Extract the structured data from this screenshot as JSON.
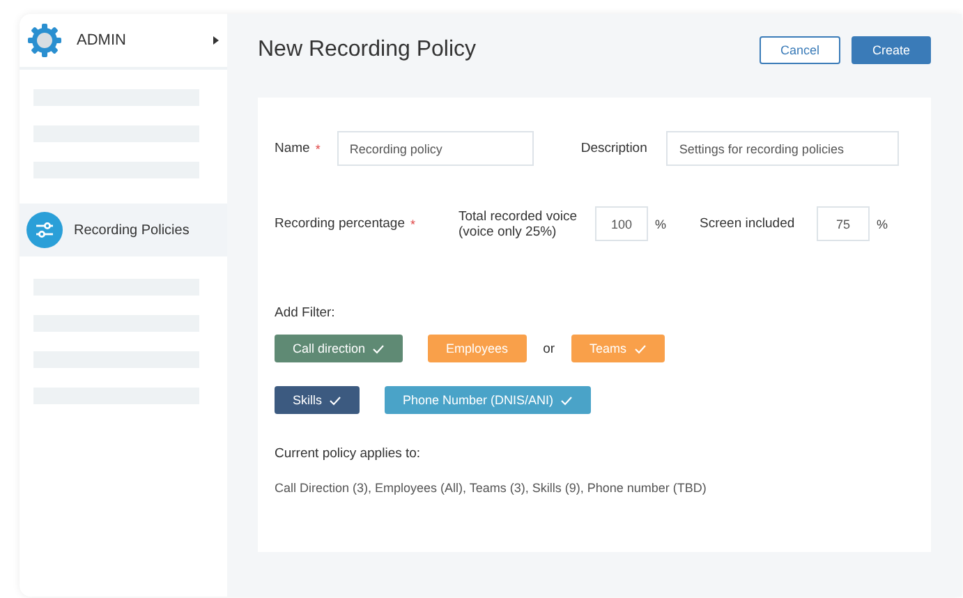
{
  "sidebar": {
    "title": "ADMIN",
    "items": [
      {
        "kind": "placeholder"
      },
      {
        "kind": "placeholder"
      },
      {
        "kind": "placeholder"
      },
      {
        "kind": "item",
        "label": "Recording Policies",
        "selected": true
      },
      {
        "kind": "placeholder"
      },
      {
        "kind": "placeholder"
      },
      {
        "kind": "placeholder"
      },
      {
        "kind": "placeholder"
      }
    ]
  },
  "page": {
    "title": "New Recording Policy",
    "buttons": [
      {
        "label": "Cancel",
        "kind": "secondary"
      },
      {
        "label": "Create",
        "kind": "primary"
      }
    ]
  },
  "form": {
    "name": {
      "label": "Name",
      "required_mark": "*",
      "value": "Recording policy"
    },
    "description": {
      "label": "Description",
      "value": "Settings for recording policies"
    },
    "recording": {
      "label": "Recording percentage",
      "required_mark": "*",
      "total_label": "Total recorded voice (voice only 25%)",
      "total_value": "100",
      "total_unit": "%",
      "screen_label": "Screen included",
      "screen_value": "75",
      "screen_unit": "%"
    },
    "filter_label": "Add Filter:",
    "filter_rows": [
      [
        {
          "kind": "filter",
          "label": "Call direction",
          "checked": true,
          "color": "#5f8a74"
        },
        {
          "kind": "filter",
          "label": "Employees",
          "checked": false,
          "color": "#f9a04a"
        },
        {
          "kind": "connector",
          "label": "or"
        },
        {
          "kind": "filter",
          "label": "Teams",
          "checked": true,
          "color": "#f9a04a"
        }
      ],
      [
        {
          "kind": "filter",
          "label": "Skills",
          "checked": true,
          "color": "#3c5a80"
        },
        {
          "kind": "filter",
          "label": "Phone Number (DNIS/ANI)",
          "checked": true,
          "color": "#4aa3c8"
        }
      ]
    ],
    "applies_label": "Current policy applies to:",
    "applies_text": "Call Direction (3),  Employees (All), Teams (3), Skills (9), Phone number (TBD)"
  }
}
